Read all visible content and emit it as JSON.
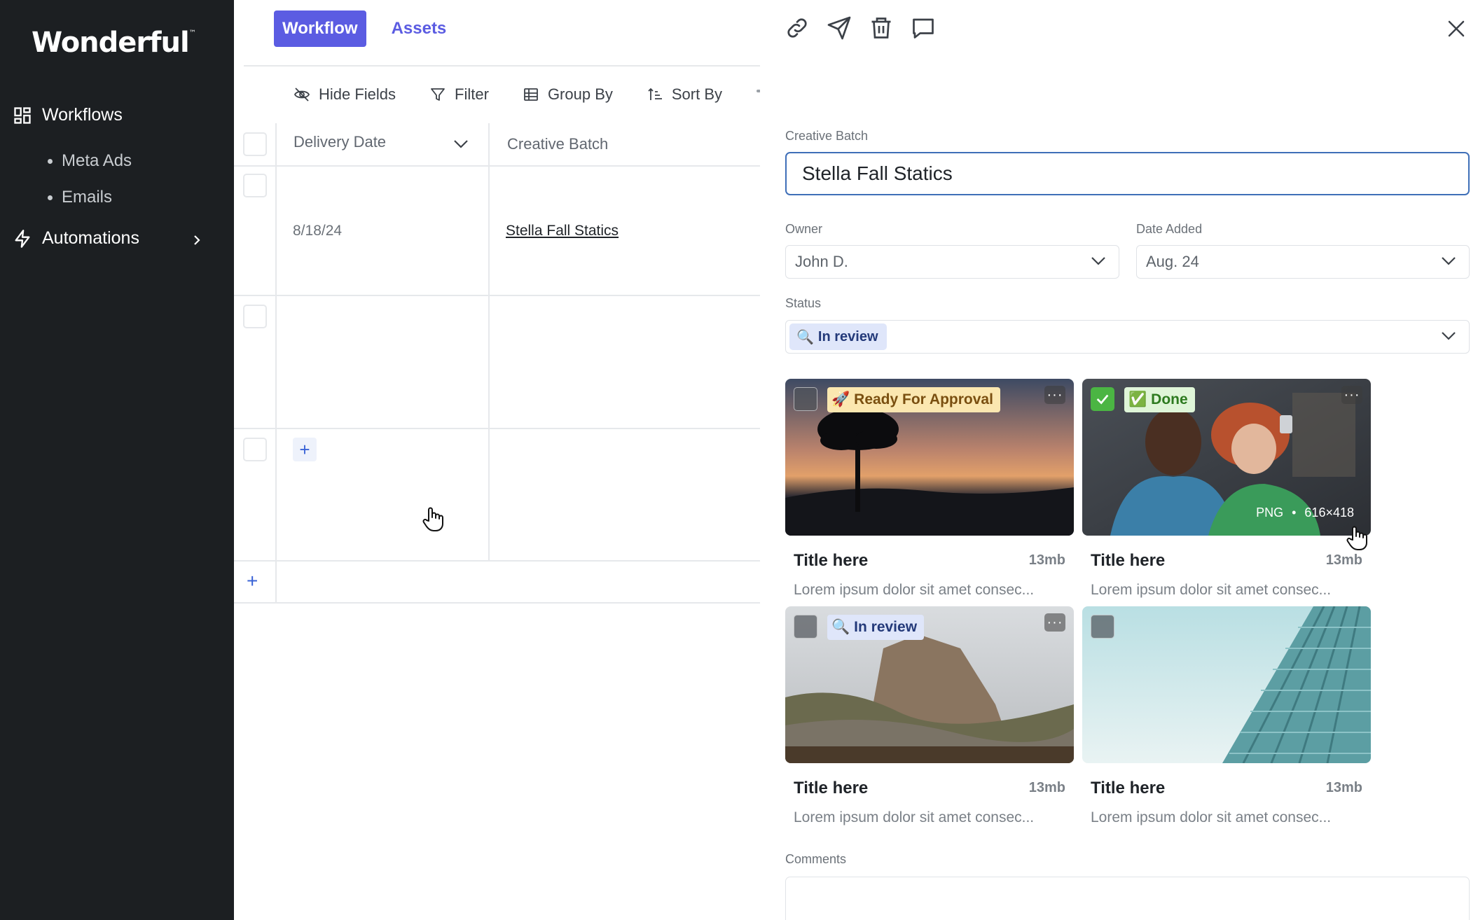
{
  "app": {
    "logo": "Wonderful",
    "logo_tm": "™"
  },
  "sidebar": {
    "workflows_label": "Workflows",
    "sub_items": [
      "Meta Ads",
      "Emails"
    ],
    "automations_label": "Automations"
  },
  "tabs": [
    {
      "label": "Workflow",
      "active": true
    },
    {
      "label": "Assets",
      "active": false
    }
  ],
  "toolbar": {
    "hide_fields": "Hide Fields",
    "filter": "Filter",
    "group_by": "Group By",
    "sort_by": "Sort By"
  },
  "table": {
    "columns": [
      "Delivery Date",
      "Creative Batch"
    ],
    "rows": [
      {
        "delivery_date": "8/18/24",
        "creative_batch": "Stella Fall Statics"
      },
      {
        "delivery_date": "",
        "creative_batch": ""
      },
      {
        "delivery_date": "",
        "creative_batch": ""
      }
    ],
    "add_glyph": "+"
  },
  "panel": {
    "creative_batch_label": "Creative Batch",
    "creative_batch_value": "Stella Fall Statics",
    "owner_label": "Owner",
    "owner_value": "John D.",
    "date_added_label": "Date Added",
    "date_added_value": "Aug. 24",
    "status_label": "Status",
    "status_value": "In review",
    "status_emoji": "🔍",
    "comments_label": "Comments",
    "assets": [
      {
        "title": "Title here",
        "size": "13mb",
        "desc": "Lorem ipsum dolor sit amet consec...",
        "badge": "Ready For Approval",
        "badge_emoji": "🚀",
        "checked": false
      },
      {
        "title": "Title here",
        "size": "13mb",
        "desc": "Lorem ipsum dolor sit amet consec...",
        "badge": "Done",
        "badge_emoji": "✅",
        "checked": true,
        "format": "PNG",
        "sep": "•",
        "dimensions": "616×418"
      },
      {
        "title": "Title here",
        "size": "13mb",
        "desc": "Lorem ipsum dolor sit amet consec...",
        "badge": "In review",
        "badge_emoji": "🔍",
        "checked": false
      },
      {
        "title": "Title here",
        "size": "13mb",
        "desc": "Lorem ipsum dolor sit amet consec...",
        "checked": false
      }
    ],
    "more_glyph": "···"
  },
  "colors": {
    "accent": "#5b5ce2",
    "sidebar_bg": "#1c1f22",
    "input_focus": "#3f6fb8",
    "link_blue": "#3a63d6"
  }
}
